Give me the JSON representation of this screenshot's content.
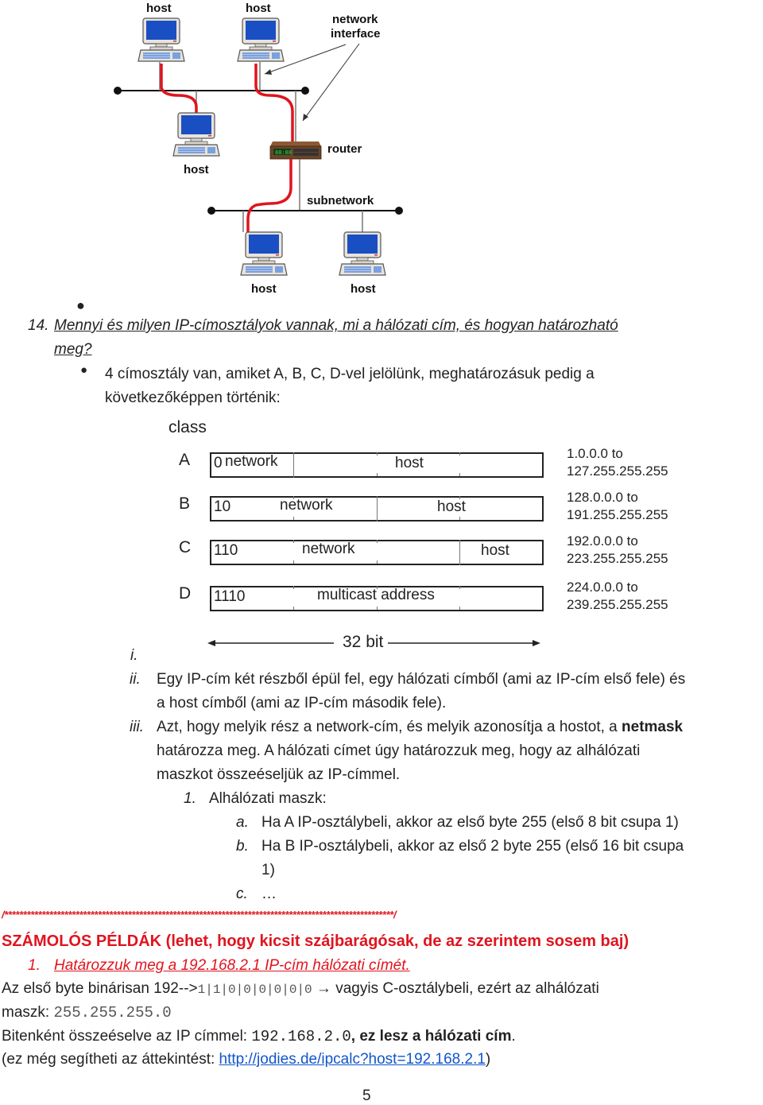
{
  "network_diagram": {
    "labels": {
      "host_top_left": "host",
      "host_top_right": "host",
      "network_interface_line1": "network",
      "network_interface_line2": "interface",
      "router": "router",
      "host_mid_left": "host",
      "subnetwork": "subnetwork",
      "host_bottom_left": "host",
      "host_bottom_right": "host"
    },
    "colors": {
      "screen": "#1a4fc4",
      "cable": "#e0141e",
      "router": "#7a4a2a"
    }
  },
  "question": {
    "number": "14.",
    "text_line1": "Mennyi és milyen IP-címosztályok vannak, mi a hálózati cím, és hogyan határozható",
    "text_line2": "meg?",
    "bullet_line1": "4 címosztály van, amiket A, B, C, D-vel jelölünk, meghatározásuk pedig a",
    "bullet_line2": "következőképpen történik:"
  },
  "class_diagram": {
    "title": "class",
    "rows": [
      {
        "class": "A",
        "prefix": "0",
        "network": "network",
        "host": "host",
        "range1": "1.0.0.0 to",
        "range2": "127.255.255.255"
      },
      {
        "class": "B",
        "prefix": "10",
        "network": "network",
        "host": "host",
        "range1": "128.0.0.0 to",
        "range2": "191.255.255.255"
      },
      {
        "class": "C",
        "prefix": "110",
        "network": "network",
        "host": "host",
        "range1": "192.0.0.0 to",
        "range2": "223.255.255.255"
      },
      {
        "class": "D",
        "prefix": "1110",
        "network": "multicast address",
        "host": "",
        "range1": "224.0.0.0 to",
        "range2": "239.255.255.255"
      }
    ],
    "width_label": "32 bit"
  },
  "list": {
    "i_marker": "i.",
    "ii_marker": "ii.",
    "ii_line1": "Egy IP-cím két részből épül fel, egy hálózati címből (ami az IP-cím első fele) és",
    "ii_line2": "a host címből (ami az IP-cím második fele).",
    "iii_marker": "iii.",
    "iii_line1_pre": "Azt, hogy melyik rész a network-cím, és melyik azonosítja a hostot, a ",
    "iii_line1_bold": "netmask",
    "iii_line2": "határozza meg. A hálózati címet úgy határozzuk meg, hogy az alhálózati",
    "iii_line3": "maszkot összeéseljük az IP-címmel.",
    "sub1_marker": "1.",
    "sub1_text": "Alhálózati maszk:",
    "a_marker": "a.",
    "a_text": "Ha A IP-osztálybeli, akkor az első byte 255 (első 8 bit csupa 1)",
    "b_marker": "b.",
    "b_line1": "Ha B IP-osztálybeli, akkor az első 2 byte 255 (első 16 bit csupa",
    "b_line2": "1)",
    "c_marker": "c.",
    "c_text": "…"
  },
  "examples": {
    "separator": "/********************************************************************************************************/",
    "heading": "SZÁMOLÓS PÉLDÁK (lehet, hogy kicsit szájbarágósak, de az szerintem sosem baj)",
    "item1_marker": "1.",
    "item1_text": "Határozzuk meg a 192.168.2.1 IP-cím hálózati címét.",
    "line1_pre": "Az első byte binárisan 192-->",
    "line1_bits": "1|1|0|0|0|0|0|0",
    "line1_post": " → vagyis C-osztálybeli, ezért az alhálózati",
    "line2_pre": "maszk: ",
    "line2_mask": "255.255.255.0",
    "line3_pre": "Bitenként összeéselve az IP címmel: ",
    "line3_ip": "192.168.2.0",
    "line3_bold": ", ez lesz a hálózati cím",
    "line3_end": ".",
    "line4_pre": "(ez még segítheti az áttekintést: ",
    "line4_link": "http://jodies.de/ipcalc?host=192.168.2.1",
    "line4_post": ")",
    "accent_color": "#e0141e",
    "link_color": "#1155cc"
  },
  "page_number": "5"
}
